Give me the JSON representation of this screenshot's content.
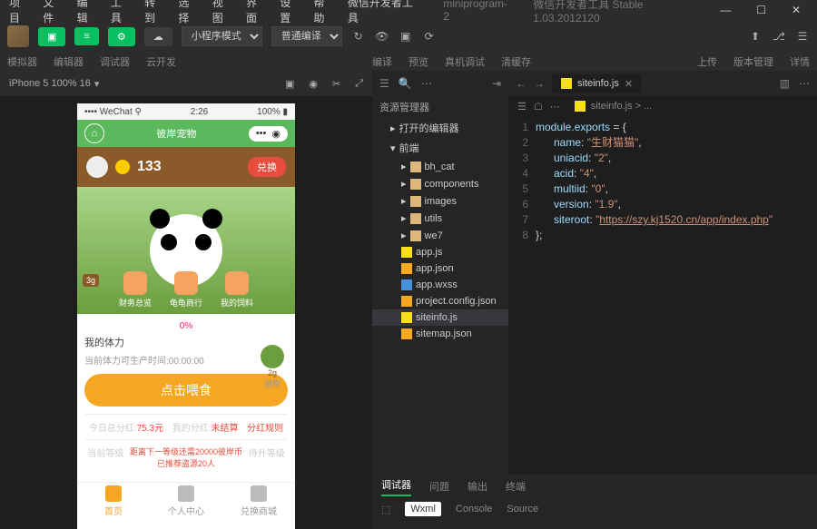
{
  "menu": [
    "项目",
    "文件",
    "编辑",
    "工具",
    "转到",
    "选择",
    "视图",
    "界面",
    "设置",
    "帮助",
    "微信开发者工具"
  ],
  "projectName": "miniprogram-2",
  "windowTitle": "微信开发者工具 Stable 1.03.2012120",
  "selects": {
    "mode": "小程序模式",
    "compile": "普通编译"
  },
  "subtabs": {
    "left": [
      "模拟器",
      "编辑器",
      "调试器",
      "云开发"
    ],
    "right": [
      "编译",
      "预览",
      "真机调试",
      "清缓存"
    ],
    "far": [
      "上传",
      "版本管理",
      "详情"
    ]
  },
  "simHeader": "iPhone 5 100% 16",
  "statusbar": {
    "carrier": "WeChat",
    "time": "2:26",
    "battery": "100%"
  },
  "nav": {
    "title": "彼岸宠物"
  },
  "app": {
    "points": "133",
    "exchange": "兑换",
    "tag3g": "3g",
    "miniBtns": [
      {
        "label": "财务总览"
      },
      {
        "label": "龟龟商行"
      },
      {
        "label": "我的饲料"
      }
    ],
    "pct": "0%",
    "physLabel": "我的体力",
    "physText": "当前体力可生产时间:00:00:00",
    "feedBtn": "点击喂食",
    "foodTag": "2g",
    "foodLabel": "遛狗",
    "stats": {
      "today": "今日总分红:",
      "todayVal": "75.3元",
      "mine": "我的分红:",
      "mineVal": "未结算",
      "rules": "分红规则"
    },
    "level": {
      "cur": "当前等级",
      "hint1": "距离下一等级还需20000彼岸币",
      "hint2": "已推荐盗源20人",
      "next": "待升等级"
    },
    "tabs": [
      "首页",
      "个人中心",
      "兑换商城"
    ]
  },
  "explorer": {
    "title": "资源管理器",
    "openEditors": "打开的编辑器",
    "root": "前端",
    "folders": [
      "bh_cat",
      "components",
      "images",
      "utils",
      "we7"
    ],
    "files": [
      "app.js",
      "app.json",
      "app.wxss",
      "project.config.json",
      "siteinfo.js",
      "sitemap.json"
    ]
  },
  "editor": {
    "tab": "siteinfo.js",
    "crumb": "siteinfo.js > ...",
    "code": {
      "l1": {
        "a": "module",
        "b": ".",
        "c": "exports",
        "d": " = {"
      },
      "l2": {
        "k": "name",
        "v": "生财猫猫"
      },
      "l3": {
        "k": "uniacid",
        "v": "2"
      },
      "l4": {
        "k": "acid",
        "v": "4"
      },
      "l5": {
        "k": "multiid",
        "v": "0"
      },
      "l6": {
        "k": "version",
        "v": "1.9"
      },
      "l7": {
        "k": "siteroot",
        "v": "https://szy.kj1520.cn/app/index.php"
      },
      "l8": "};"
    }
  },
  "debugger": {
    "tabs": [
      "调试器",
      "问题",
      "输出",
      "终端"
    ],
    "sub": [
      "Wxml",
      "Console",
      "Source"
    ]
  }
}
